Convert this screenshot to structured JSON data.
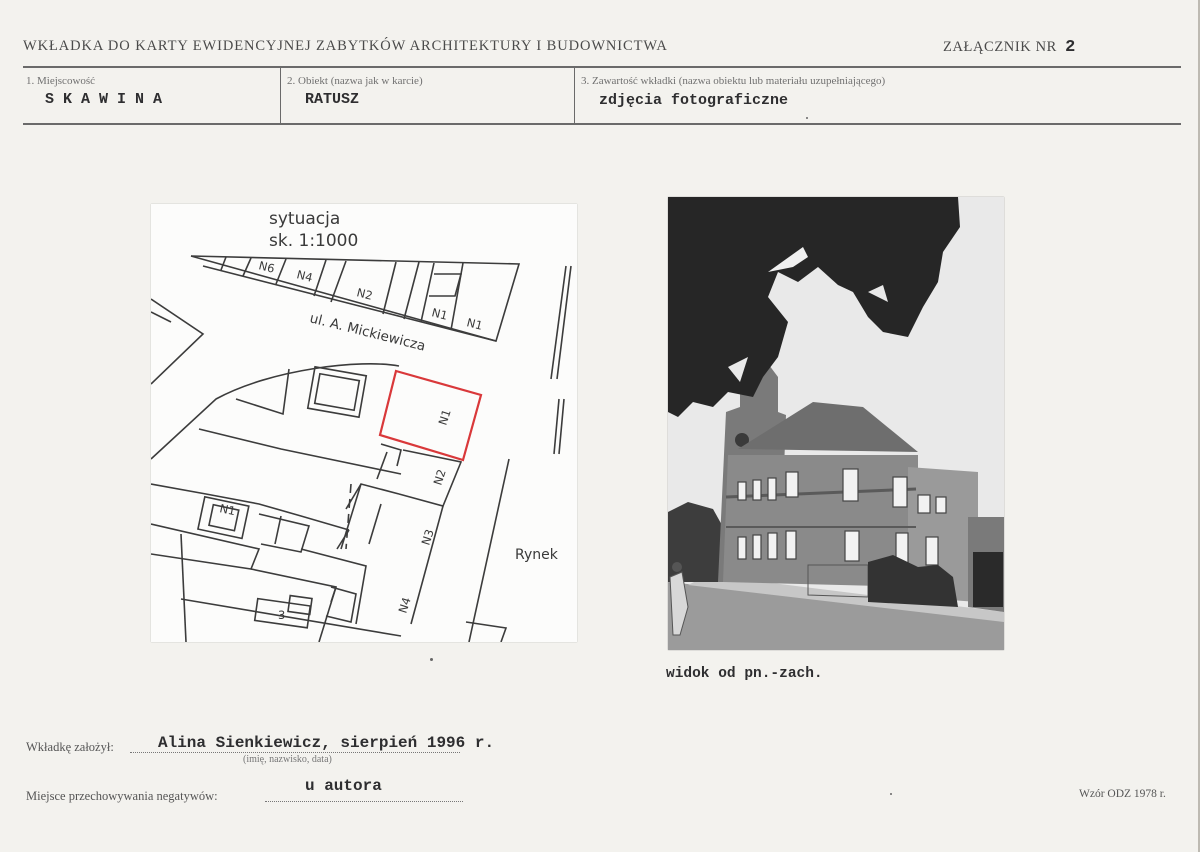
{
  "header": {
    "title": "WKŁADKA DO KARTY EWIDENCYJNEJ ZABYTKÓW ARCHITEKTURY I BUDOWNICTWA",
    "attachment_label": "ZAŁĄCZNIK NR",
    "attachment_number": "2"
  },
  "fields": {
    "place_label": "1. Miejscowość",
    "place_value": "SKAWINA",
    "object_label": "2. Obiekt (nazwa jak w karcie)",
    "object_value": "RATUSZ",
    "content_label": "3. Zawartość wkładki (nazwa obiektu lub materiału uzupełniającego)",
    "content_value": "zdjęcia fotograficzne"
  },
  "map": {
    "title_line1": "sytuacja",
    "title_line2": "sk. 1:1000",
    "street": "ul. A. Mickiewicza",
    "square": "Rynek",
    "lot_labels": [
      "N6",
      "N4",
      "N2",
      "N1",
      "N1",
      "N1",
      "N2",
      "N3",
      "N4",
      "N1",
      "3"
    ]
  },
  "photo": {
    "caption": "widok od pn.-zach."
  },
  "footer": {
    "author_label": "Wkładkę założył:",
    "author_value": "Alina Sienkiewicz, sierpień 1996 r.",
    "author_hint": "(imię, nazwisko, data)",
    "storage_label": "Miejsce przechowywania negatywów:",
    "storage_value": "u autora",
    "form_id": "Wzór ODZ 1978 r."
  },
  "colors": {
    "paper": "#f3f2ee",
    "highlight_outline": "#d9383a",
    "ink": "#2e2e30"
  }
}
